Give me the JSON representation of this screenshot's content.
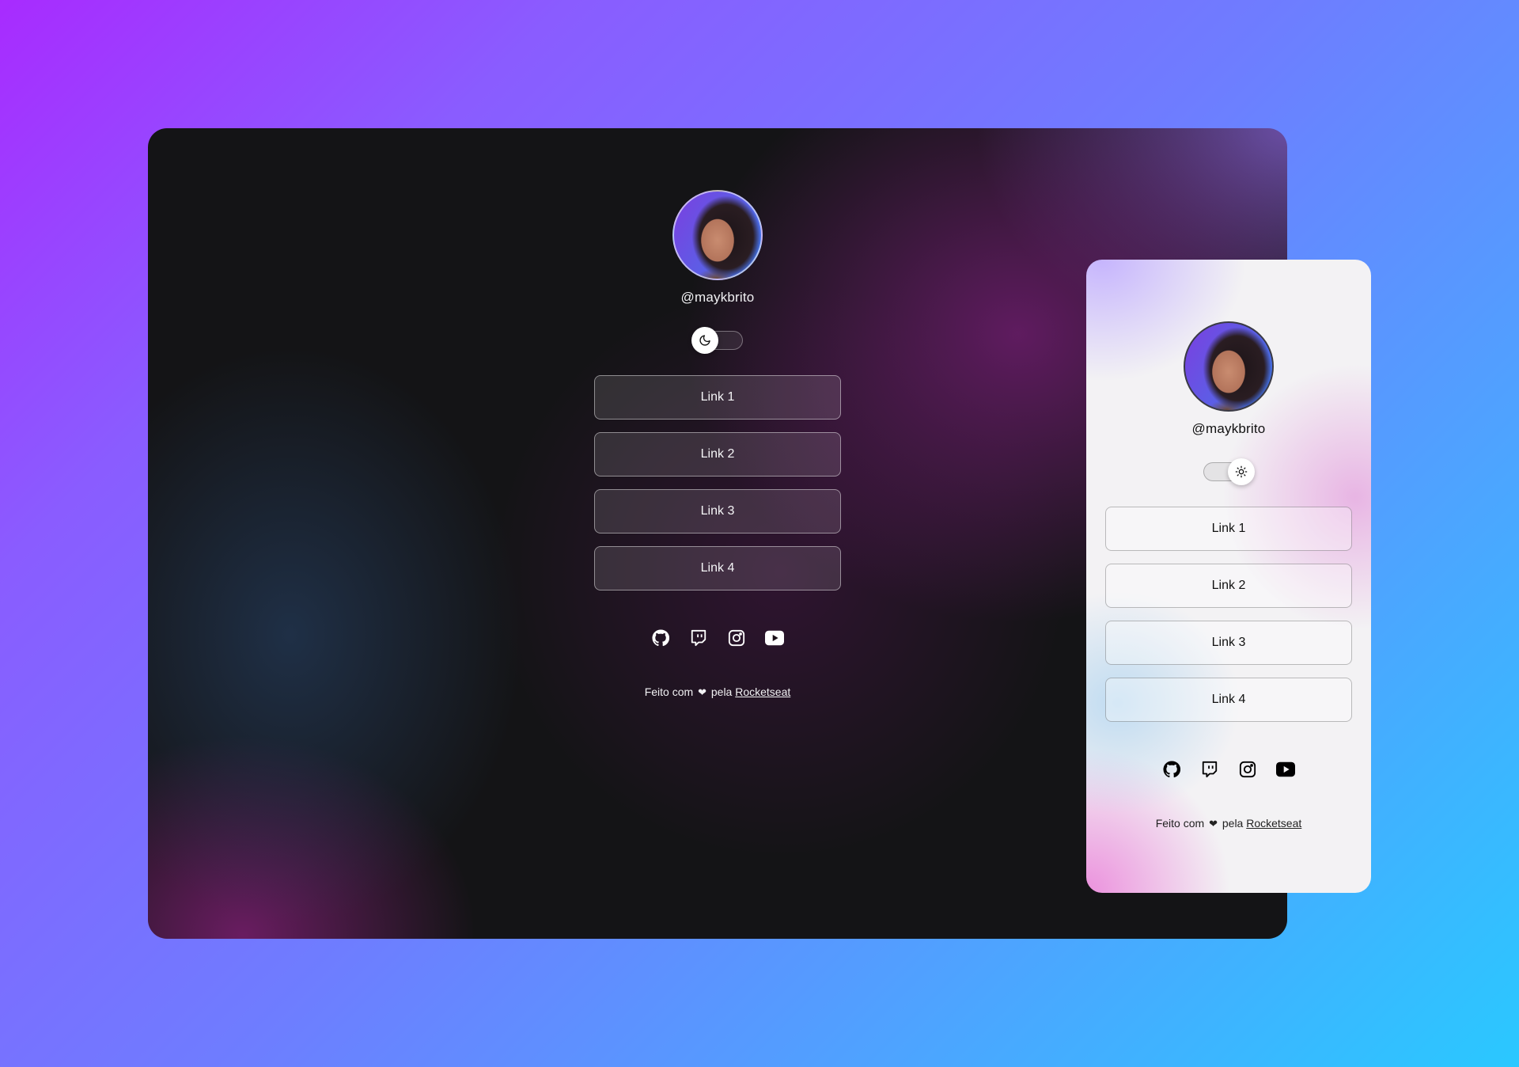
{
  "desktop": {
    "handle": "@maykbrito",
    "theme_toggle_icon": "moon-icon",
    "links": [
      {
        "label": "Link 1"
      },
      {
        "label": "Link 2"
      },
      {
        "label": "Link 3"
      },
      {
        "label": "Link 4"
      }
    ],
    "socials": [
      "github-icon",
      "twitch-icon",
      "instagram-icon",
      "youtube-icon"
    ],
    "footer": {
      "prefix": "Feito com",
      "heart": "❤",
      "middle": "pela",
      "link_label": "Rocketseat"
    }
  },
  "mobile": {
    "handle": "@maykbrito",
    "theme_toggle_icon": "sun-icon",
    "links": [
      {
        "label": "Link 1"
      },
      {
        "label": "Link 2"
      },
      {
        "label": "Link 3"
      },
      {
        "label": "Link 4"
      }
    ],
    "socials": [
      "github-icon",
      "twitch-icon",
      "instagram-icon",
      "youtube-icon"
    ],
    "footer": {
      "prefix": "Feito com",
      "heart": "❤",
      "middle": "pela",
      "link_label": "Rocketseat"
    }
  },
  "colors": {
    "background_start": "#a82bff",
    "background_end": "#2ac8ff",
    "dark_surface": "#141416",
    "light_surface": "#f3f2f4"
  }
}
